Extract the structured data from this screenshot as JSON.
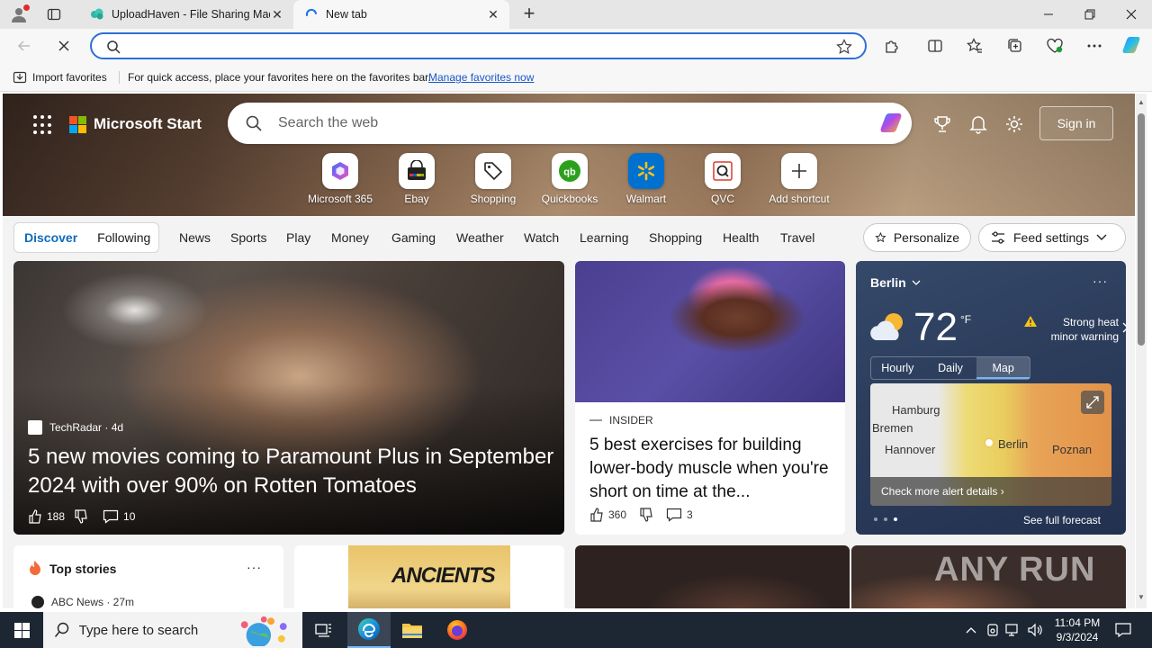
{
  "browser": {
    "tabs": [
      {
        "title": "UploadHaven - File Sharing Made Simple",
        "active": false
      },
      {
        "title": "New tab",
        "active": true
      }
    ],
    "address_placeholder": ""
  },
  "favorites_bar": {
    "import_label": "Import favorites",
    "hint": "For quick access, place your favorites here on the favorites bar.",
    "manage_link": "Manage favorites now"
  },
  "page": {
    "brand": "Microsoft Start",
    "search_placeholder": "Search the web",
    "sign_in": "Sign in",
    "shortcuts": [
      {
        "label": "Microsoft 365",
        "icon": "microsoft-365-icon"
      },
      {
        "label": "Ebay",
        "icon": "ebay-icon"
      },
      {
        "label": "Shopping",
        "icon": "shopping-tag-icon"
      },
      {
        "label": "Quickbooks",
        "icon": "quickbooks-icon"
      },
      {
        "label": "Walmart",
        "icon": "walmart-icon"
      },
      {
        "label": "QVC",
        "icon": "qvc-icon"
      },
      {
        "label": "Add shortcut",
        "icon": "plus-icon"
      }
    ],
    "feed_tabs": [
      "Discover",
      "Following"
    ],
    "nav": [
      "News",
      "Sports",
      "Play",
      "Money",
      "Gaming",
      "Weather",
      "Watch",
      "Learning",
      "Shopping",
      "Health",
      "Travel"
    ],
    "personalize": "Personalize",
    "feed_settings": "Feed settings",
    "hero": {
      "source": "TechRadar · 4d",
      "title": "5 new movies coming to Paramount Plus in September 2024 with over 90% on Rotten Tomatoes",
      "likes": "188",
      "comments": "10"
    },
    "article": {
      "source": "INSIDER",
      "title": "5 best exercises for building lower-body muscle when you're short on time at the...",
      "likes": "360",
      "comments": "3"
    },
    "weather": {
      "city": "Berlin",
      "temp": "72",
      "unit": "°F",
      "alert_line1": "Strong heat",
      "alert_line2": "minor warning",
      "tabs": [
        "Hourly",
        "Daily",
        "Map"
      ],
      "map_labels": [
        "Hamburg",
        "Bremen",
        "Hannover",
        "Berlin",
        "Poznan"
      ],
      "map_cta": "Check more alert details",
      "forecast_link": "See full forecast"
    },
    "top_stories": {
      "title": "Top stories",
      "source": "ABC News · 27m"
    },
    "promo_text": "ANCIENTS",
    "watermark": "ANY RUN"
  },
  "taskbar": {
    "search_placeholder": "Type here to search",
    "time": "11:04 PM",
    "date": "9/3/2024"
  },
  "colors": {
    "accent": "#0f6cbd",
    "address_border": "#2e6fd8",
    "taskbar": "#1d2733"
  }
}
